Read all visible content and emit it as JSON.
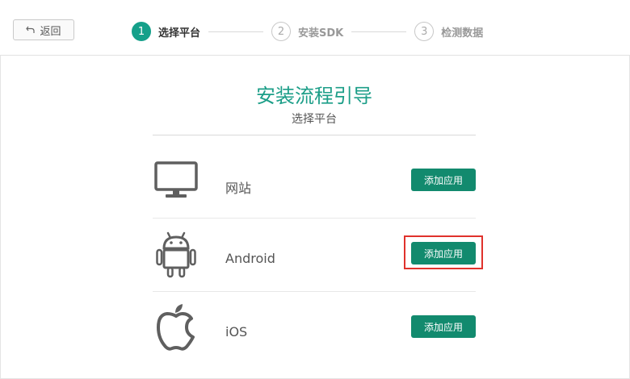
{
  "header": {
    "back_label": "返回",
    "steps": [
      {
        "num": "1",
        "label": "选择平台"
      },
      {
        "num": "2",
        "label": "安装SDK"
      },
      {
        "num": "3",
        "label": "检测数据"
      }
    ]
  },
  "main": {
    "title": "安装流程引导",
    "subtitle": "选择平台",
    "platforms": [
      {
        "label": "网站",
        "icon": "monitor-icon",
        "button": "添加应用"
      },
      {
        "label": "Android",
        "icon": "android-icon",
        "button": "添加应用"
      },
      {
        "label": "iOS",
        "icon": "apple-icon",
        "button": "添加应用"
      }
    ]
  },
  "colors": {
    "accent": "#15a08a",
    "button": "#128a6e",
    "highlight": "#e0322c"
  }
}
